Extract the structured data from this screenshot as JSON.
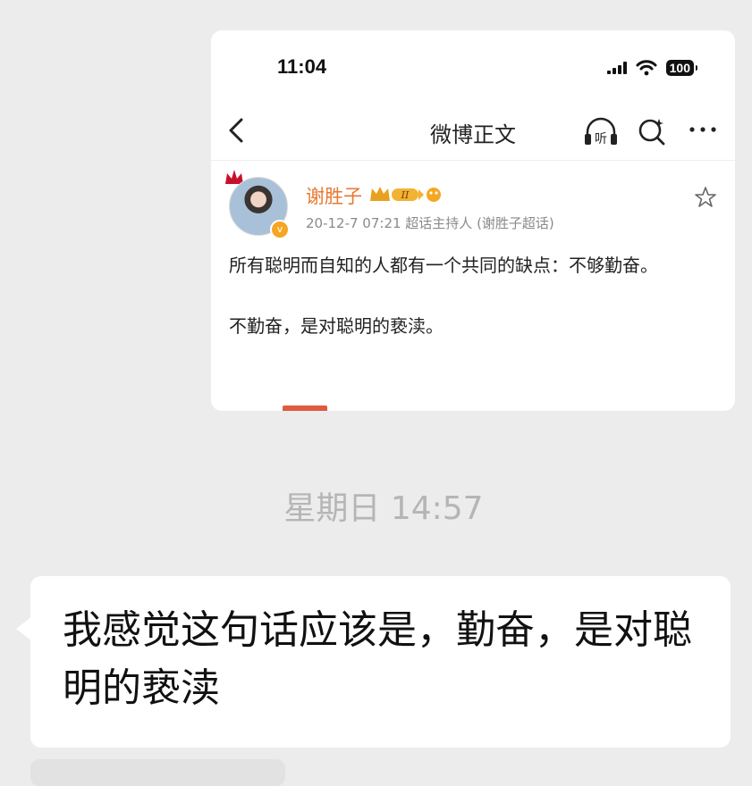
{
  "screenshot": {
    "status_bar": {
      "time": "11:04",
      "battery": "100"
    },
    "nav": {
      "title": "微博正文",
      "listen_label": "听"
    },
    "post": {
      "author": "谢胜子",
      "vip_level": "II",
      "meta": "20-12-7 07:21  超话主持人 (谢胜子超话)",
      "paragraphs": [
        "所有聪明而自知的人都有一个共同的缺点：不够勤奋。",
        "不勤奋，是对聪明的亵渎。"
      ]
    }
  },
  "chat": {
    "timestamp": "星期日 14:57",
    "message": "我感觉这句话应该是，勤奋，是对聪明的亵渎"
  },
  "colors": {
    "username": "#e8772e",
    "page_background": "#ececec",
    "timestamp": "#b5b5b5"
  }
}
